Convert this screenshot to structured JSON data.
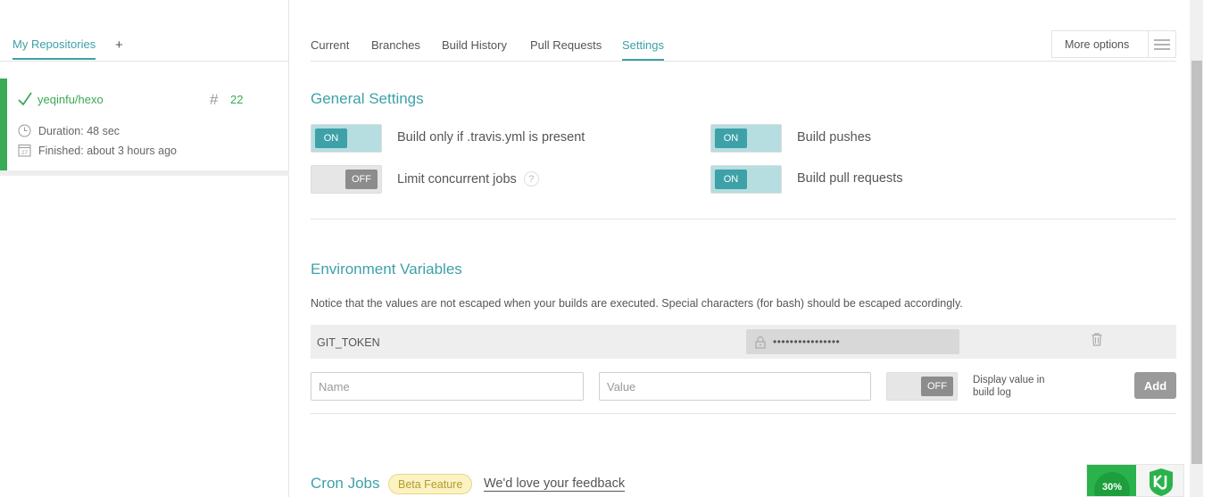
{
  "sidebar": {
    "tab_my_repositories": "My Repositories",
    "add_label": "+",
    "repo": {
      "name": "yeqinfu/hexo",
      "build_number": "22",
      "duration": "Duration: 48 sec",
      "finished": "Finished: about 3 hours ago"
    }
  },
  "tabs": {
    "items": [
      "Current",
      "Branches",
      "Build History",
      "Pull Requests",
      "Settings"
    ],
    "active": "Settings",
    "more_options": "More options"
  },
  "general_settings": {
    "title": "General Settings",
    "build_only_travis": {
      "label": "Build only if .travis.yml is present",
      "state": "ON"
    },
    "build_pushes": {
      "label": "Build pushes",
      "state": "ON"
    },
    "limit_concurrent": {
      "label": "Limit concurrent jobs",
      "state": "OFF",
      "help": "?"
    },
    "build_pull_requests": {
      "label": "Build pull requests",
      "state": "ON"
    }
  },
  "env_vars": {
    "title": "Environment Variables",
    "notice": "Notice that the values are not escaped when your builds are executed. Special characters (for bash) should be escaped accordingly.",
    "existing": {
      "name": "GIT_TOKEN",
      "value": "••••••••••••••••"
    },
    "name_placeholder": "Name",
    "value_placeholder": "Value",
    "display_toggle_state": "OFF",
    "display_label": "Display value in build log",
    "add_label": "Add"
  },
  "cron": {
    "title": "Cron Jobs",
    "beta": "Beta Feature",
    "feedback": "We'd love your feedback"
  },
  "widget": {
    "percent": "30%"
  },
  "colors": {
    "accent": "#3ea1a8",
    "success": "#39aa56",
    "toggle_on": "#b6dde0"
  }
}
